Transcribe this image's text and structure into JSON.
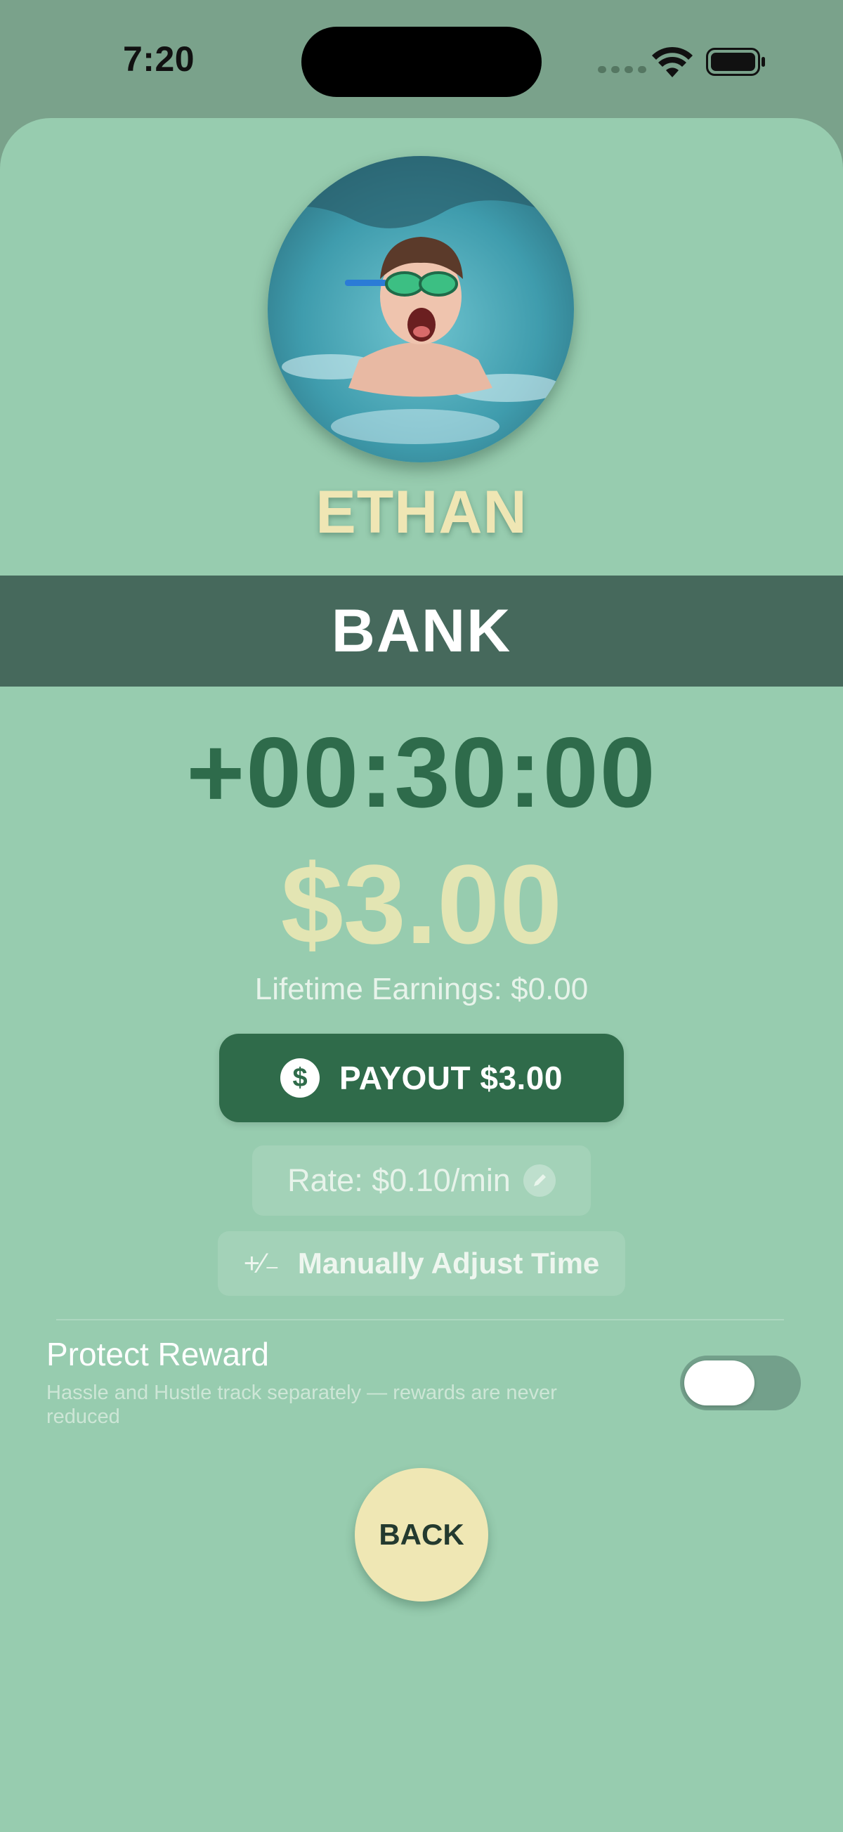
{
  "status_bar": {
    "time": "7:20",
    "icons": [
      "cellular-signal-icon",
      "wifi-icon",
      "battery-icon"
    ]
  },
  "profile": {
    "name": "ETHAN",
    "avatar": "photo-of-child-swimming-in-pool"
  },
  "bank": {
    "title": "BANK",
    "timer": "+00:30:00",
    "amount": "$3.00",
    "lifetime_earnings": "Lifetime Earnings: $0.00",
    "payout_label": "PAYOUT $3.00",
    "payout_icon_glyph": "$",
    "rate_label": "Rate: $0.10/min",
    "adjust_icon_glyph": "+∕₋",
    "adjust_label": "Manually Adjust Time"
  },
  "protect_reward": {
    "title": "Protect Reward",
    "description": "Hassle and Hustle track separately — rewards are never reduced",
    "toggle_on": false
  },
  "back_label": "BACK",
  "colors": {
    "status_background": "#7aa28b",
    "sheet_background": "#97ccaf",
    "banner": "#46695c",
    "timer_text": "#2e6b4b",
    "amount_text": "#e3e5b3",
    "name_text": "#efe6b4",
    "payout_button": "#2f6b4a",
    "back_button": "#efe7b4"
  }
}
